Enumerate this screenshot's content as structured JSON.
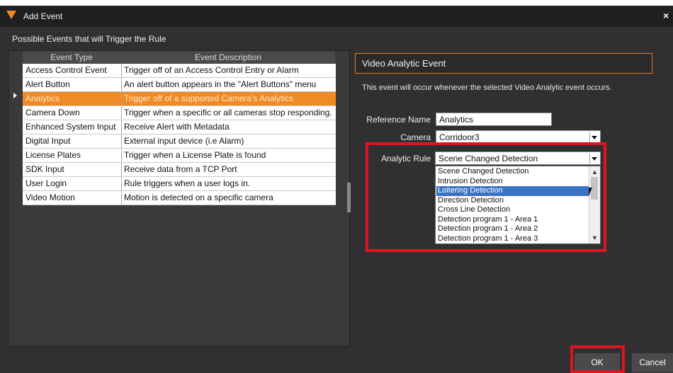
{
  "window": {
    "title": "Add Event",
    "close_glyph": "×"
  },
  "section_label": "Possible Events that will Trigger the Rule",
  "table": {
    "columns": [
      "Event Type",
      "Event Description"
    ],
    "rows": [
      {
        "type": "Access Control Event",
        "desc": "Trigger off of an Access Control Entry or Alarm",
        "selected": false
      },
      {
        "type": "Alert Button",
        "desc": "An alert button appears in the \"Alert Buttons\" menu",
        "selected": false
      },
      {
        "type": "Analytics",
        "desc": "Trigger off of a supported Camera's Analytics",
        "selected": true
      },
      {
        "type": "Camera Down",
        "desc": "Trigger when a specific or all cameras stop responding.",
        "selected": false
      },
      {
        "type": "Enhanced System Input",
        "desc": "Receive Alert with Metadata",
        "selected": false
      },
      {
        "type": "Digital Input",
        "desc": "External input device (i.e Alarm)",
        "selected": false
      },
      {
        "type": "License Plates",
        "desc": "Trigger when a License Plate is found",
        "selected": false
      },
      {
        "type": "SDK Input",
        "desc": "Receive data from a TCP Port",
        "selected": false
      },
      {
        "type": "User Login",
        "desc": "Rule triggers when a user logs in.",
        "selected": false
      },
      {
        "type": "Video Motion",
        "desc": "Motion is detected on a specific camera",
        "selected": false
      }
    ]
  },
  "panel": {
    "header": "Video Analytic Event",
    "description": "This event will occur whenever the selected Video Analytic event occurs.",
    "reference_name_label": "Reference Name",
    "reference_name_value": "Analytics",
    "camera_label": "Camera",
    "camera_value": "Corridoor3",
    "analytic_rule_label": "Analytic Rule",
    "analytic_rule_value": "Scene Changed Detection",
    "analytic_rule_options": [
      {
        "label": "Scene Changed Detection",
        "highlighted": false
      },
      {
        "label": "Intrusion Detection",
        "highlighted": false
      },
      {
        "label": "Loitering Detection",
        "highlighted": true
      },
      {
        "label": "Direction Detection",
        "highlighted": false
      },
      {
        "label": "Cross Line Detection",
        "highlighted": false
      },
      {
        "label": "Detection program 1 - Area 1",
        "highlighted": false
      },
      {
        "label": "Detection program 1 - Area 2",
        "highlighted": false
      },
      {
        "label": "Detection program 1 - Area 3",
        "highlighted": false
      }
    ]
  },
  "buttons": {
    "ok": "OK",
    "cancel": "Cancel"
  },
  "colors": {
    "accent": "#f08a24",
    "highlight_box": "#e0141e",
    "list_highlight": "#3b73c4"
  },
  "icons": {
    "logo": "orange-triangle-logo-icon",
    "close": "close-icon",
    "dropdown": "chevron-down-icon"
  }
}
